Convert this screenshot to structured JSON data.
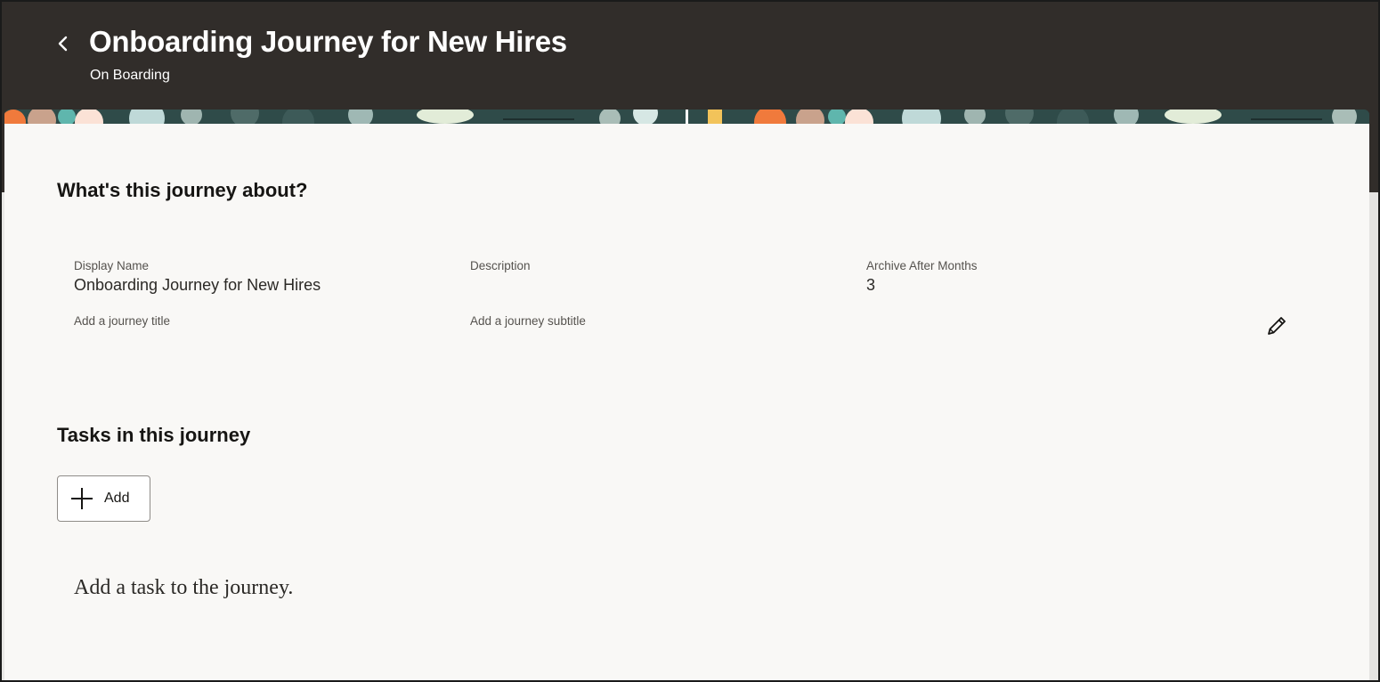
{
  "header": {
    "title": "Onboarding Journey for New Hires",
    "subtitle": "On Boarding",
    "back_icon": "chevron-left-icon"
  },
  "colors": {
    "header_bg": "#312d2a",
    "card_bg": "#f9f8f6",
    "text_primary": "#161513",
    "text_secondary": "#55524e"
  },
  "about": {
    "heading": "What's this journey about?",
    "fields": [
      {
        "label": "Display Name",
        "value": "Onboarding Journey for New Hires",
        "hint": "Add a journey title"
      },
      {
        "label": "Description",
        "value": "",
        "hint": "Add a journey subtitle"
      },
      {
        "label": "Archive After Months",
        "value": "3",
        "hint": ""
      }
    ],
    "edit_icon": "pencil-icon"
  },
  "tasks": {
    "heading": "Tasks in this journey",
    "add_label": "Add",
    "add_icon": "plus-icon",
    "empty_message": "Add a task to the journey."
  }
}
